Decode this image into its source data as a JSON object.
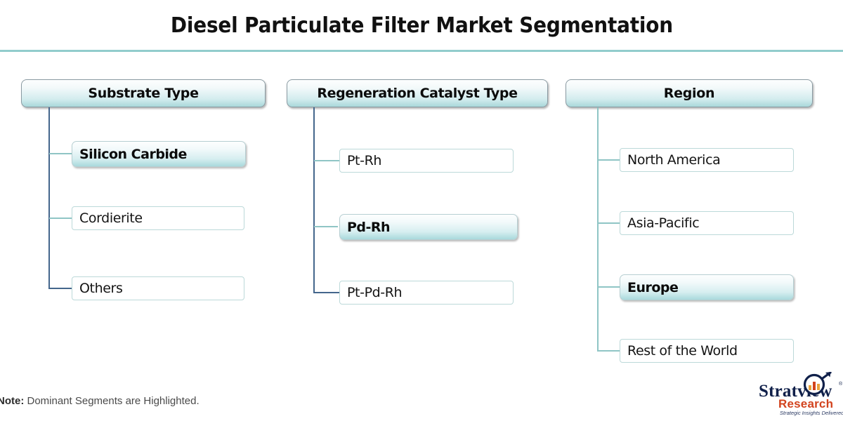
{
  "page": {
    "title": "Diesel Particulate Filter Market Segmentation",
    "note_prefix": "Note:",
    "note_text": " Dominant Segments are Highlighted.",
    "accent_rule_color": "#92cccc",
    "trunk_color": "#44668c",
    "stub_color": "#8fc5c5",
    "highlight_gradient_top": "#fdfefe",
    "highlight_gradient_bottom": "#a9d9dc"
  },
  "columns": [
    {
      "header": "Substrate Type",
      "items": [
        {
          "label": "Silicon Carbide",
          "highlighted": true
        },
        {
          "label": "Cordierite",
          "highlighted": false
        },
        {
          "label": "Others",
          "highlighted": false
        }
      ]
    },
    {
      "header": "Regeneration Catalyst Type",
      "items": [
        {
          "label": "Pt-Rh",
          "highlighted": false
        },
        {
          "label": "Pd-Rh",
          "highlighted": true
        },
        {
          "label": "Pt-Pd-Rh",
          "highlighted": false
        }
      ]
    },
    {
      "header": "Region",
      "items": [
        {
          "label": "North America",
          "highlighted": false
        },
        {
          "label": "Asia-Pacific",
          "highlighted": false
        },
        {
          "label": "Europe",
          "highlighted": true
        },
        {
          "label": "Rest of the World",
          "highlighted": false
        }
      ]
    }
  ],
  "logo": {
    "name": "Stratview",
    "trademark": "®",
    "division": "Research",
    "tagline": "Strategic Insights Delivered",
    "name_color": "#10204a",
    "division_color": "#d2431e"
  }
}
